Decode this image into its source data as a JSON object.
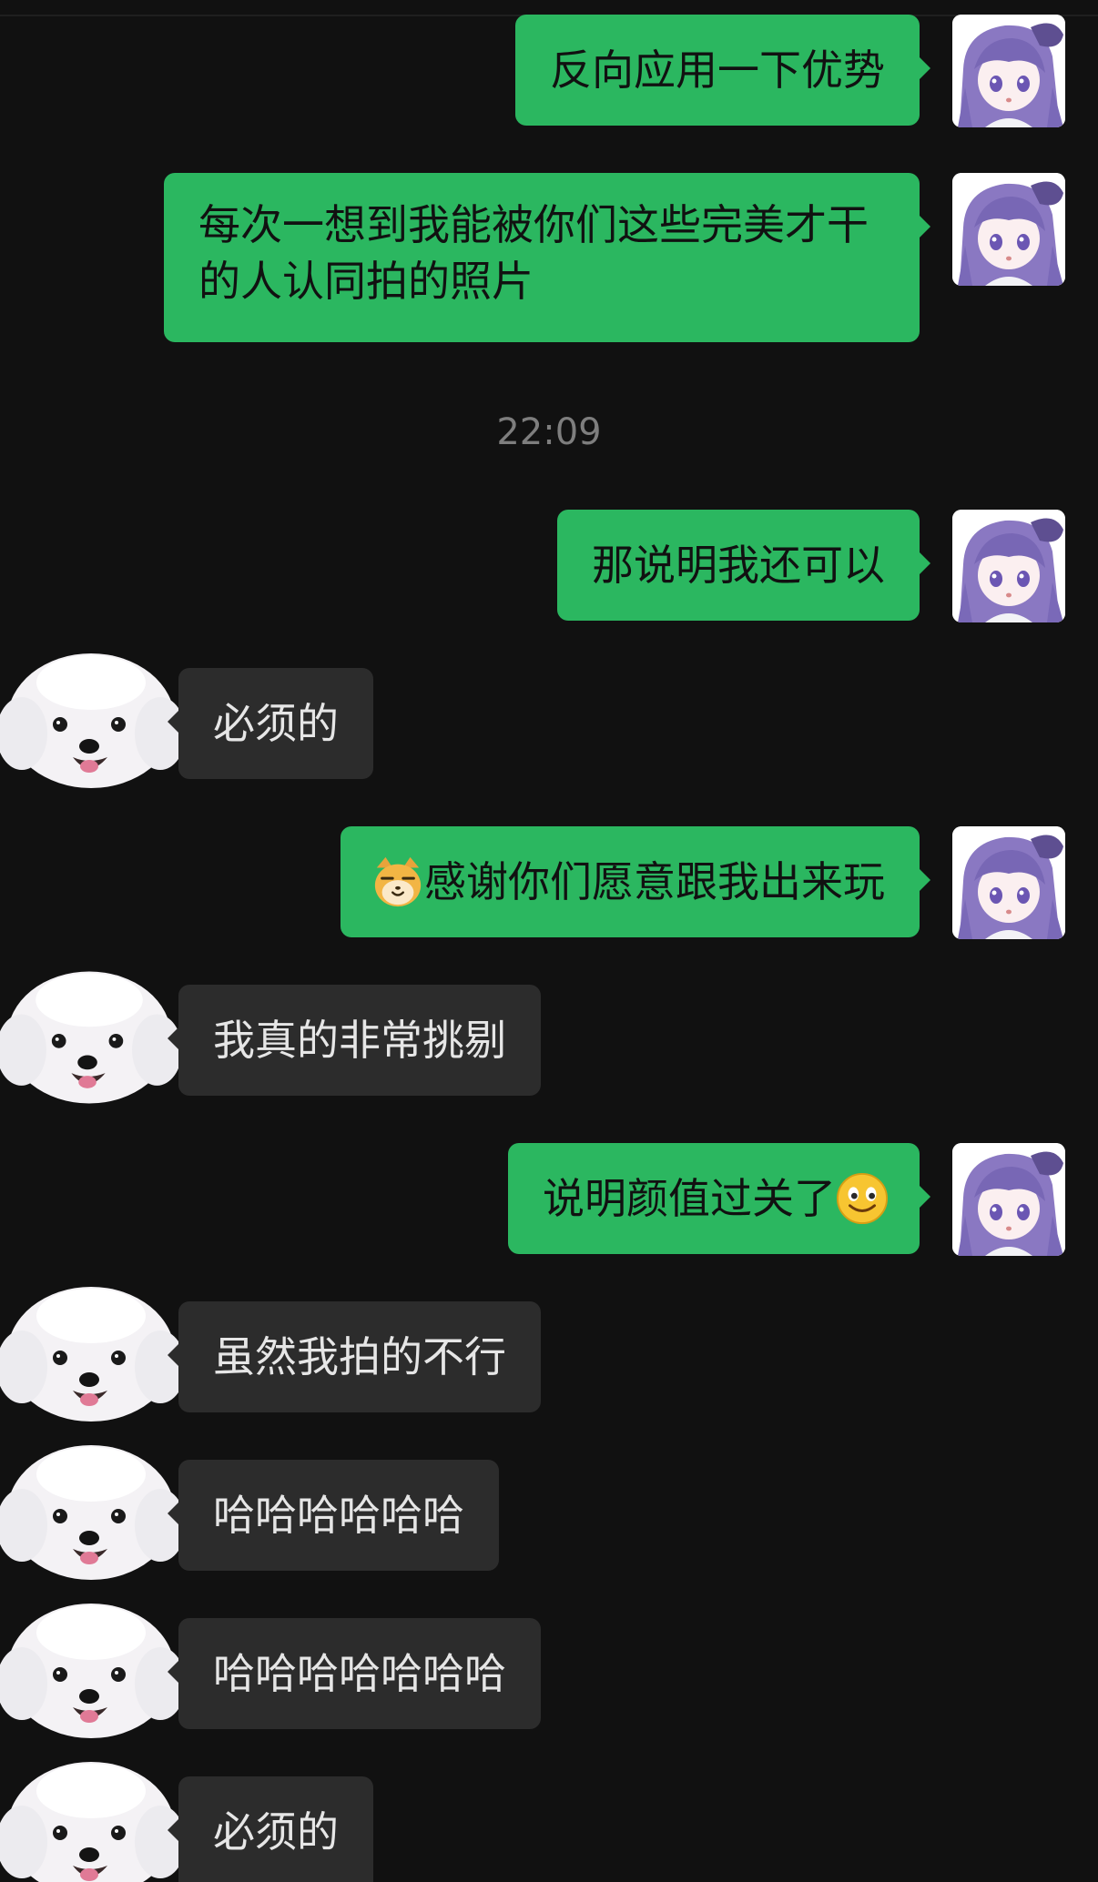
{
  "colors": {
    "background": "#111111",
    "outgoing_bubble": "#2bb760",
    "incoming_bubble": "#2c2c2c",
    "timestamp_text": "#7e7e7e"
  },
  "messages": [
    {
      "side": "out",
      "text": "反向应用一下优势",
      "avatar": "anime-girl-avatar"
    },
    {
      "side": "out",
      "text": "每次一想到我能被你们这些完美才干的人认同拍的照片",
      "avatar": "anime-girl-avatar"
    },
    {
      "type": "timestamp",
      "text": "22:09"
    },
    {
      "side": "out",
      "text": "那说明我还可以",
      "avatar": "anime-girl-avatar"
    },
    {
      "side": "in",
      "text": "必须的",
      "avatar": "bichon-dog-avatar"
    },
    {
      "side": "out",
      "emoji_before": "doge-cat-emoji",
      "text": "感谢你们愿意跟我出来玩",
      "avatar": "anime-girl-avatar"
    },
    {
      "side": "in",
      "text": "我真的非常挑剔",
      "avatar": "bichon-dog-avatar"
    },
    {
      "side": "out",
      "text": "说明颜值过关了",
      "emoji_after": "smile-emoji",
      "avatar": "anime-girl-avatar"
    },
    {
      "side": "in",
      "text": "虽然我拍的不行",
      "avatar": "bichon-dog-avatar"
    },
    {
      "side": "in",
      "text": "哈哈哈哈哈哈",
      "avatar": "bichon-dog-avatar"
    },
    {
      "side": "in",
      "text": "哈哈哈哈哈哈哈",
      "avatar": "bichon-dog-avatar"
    },
    {
      "side": "in",
      "text": "必须的",
      "avatar": "bichon-dog-avatar"
    }
  ]
}
